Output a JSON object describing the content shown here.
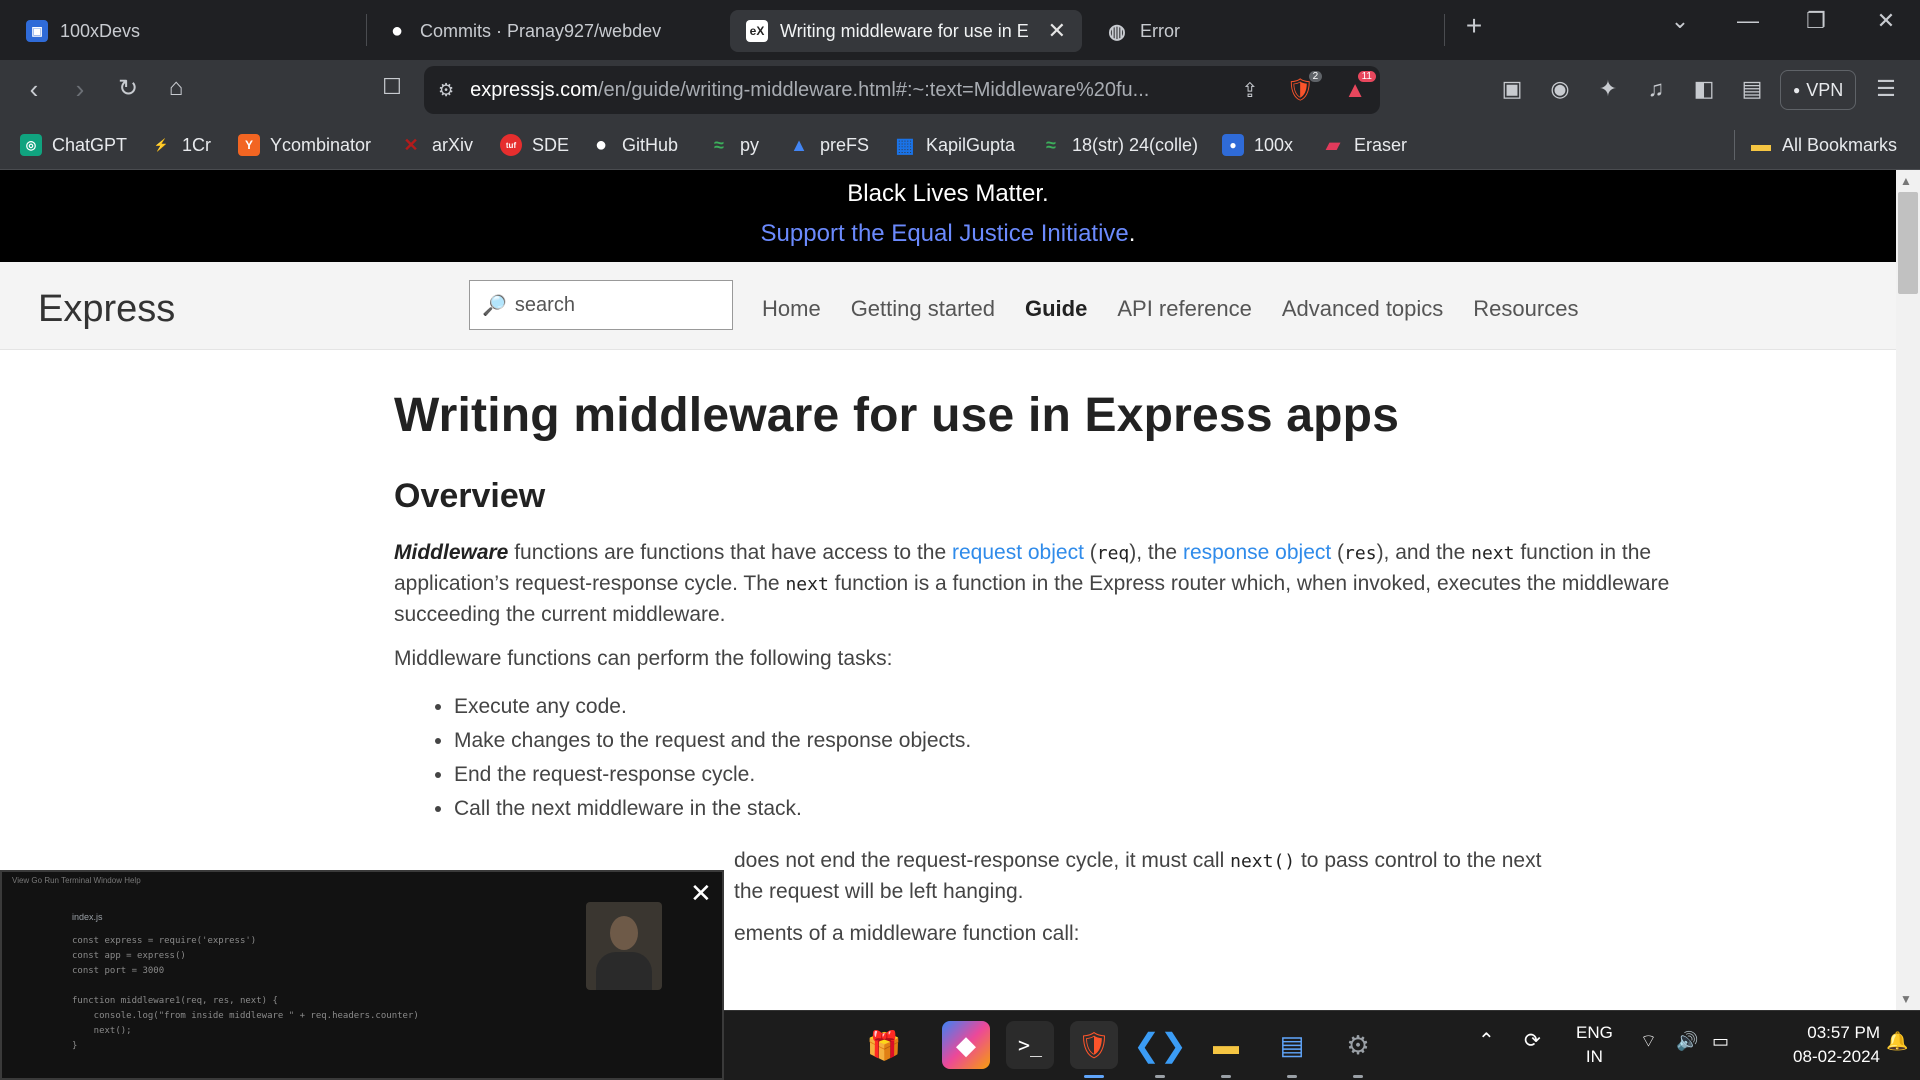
{
  "tabs": [
    {
      "title": "100xDevs",
      "icon": "window-icon"
    },
    {
      "title": "Commits · Pranay927/webdev",
      "icon": "github-icon"
    },
    {
      "title": "Writing middleware for use in Ex",
      "icon": "express-icon",
      "favicon_text": "eX"
    },
    {
      "title": "Error",
      "icon": "globe-icon"
    }
  ],
  "url": {
    "host": "expressjs.com",
    "path": "/en/guide/writing-middleware.html#:~:text=Middleware%20fu..."
  },
  "toolbar": {
    "brave_badge": "2",
    "rewards_badge": "11",
    "vpn_label": "VPN"
  },
  "bookmarks": [
    {
      "label": "ChatGPT",
      "color": "#10a37f",
      "glyph": "◎"
    },
    {
      "label": "1Cr",
      "color": "#f4a31d",
      "glyph": "⚡"
    },
    {
      "label": "Ycombinator",
      "color": "#f26522",
      "glyph": "Y"
    },
    {
      "label": "arXiv",
      "color": "#b31b1b",
      "glyph": "✕"
    },
    {
      "label": "SDE",
      "color": "#e62e2e",
      "glyph": "tuf"
    },
    {
      "label": "GitHub",
      "color": "#ffffff",
      "glyph": "●"
    },
    {
      "label": "py",
      "color": "#3cae5b",
      "glyph": "≈"
    },
    {
      "label": "preFS",
      "color": "#4285f4",
      "glyph": "▲"
    },
    {
      "label": "KapilGupta",
      "color": "#1a73e8",
      "glyph": "▦"
    },
    {
      "label": "18(str) 24(colle)",
      "color": "#3cae5b",
      "glyph": "≈"
    },
    {
      "label": "100x",
      "color": "#2f6bd8",
      "glyph": "●"
    },
    {
      "label": "Eraser",
      "color": "#e23a5b",
      "glyph": "▰"
    }
  ],
  "all_bookmarks": "All Bookmarks",
  "banner": {
    "line1": "Black Lives Matter.",
    "link": "Support the Equal Justice Initiative",
    "link_suffix": "."
  },
  "site": {
    "logo": "Express",
    "search_placeholder": "search",
    "nav": [
      "Home",
      "Getting started",
      "Guide",
      "API reference",
      "Advanced topics",
      "Resources"
    ]
  },
  "article": {
    "title": "Writing middleware for use in Express apps",
    "overview": "Overview",
    "p1_em": "Middleware",
    "p1_a": " functions are functions that have access to the ",
    "p1_link1": "request object",
    "p1_code1": "req",
    "p1_b": "), the ",
    "p1_link2": "response object",
    "p1_code2": "res",
    "p1_c": "), and the ",
    "p1_code3": "next",
    "p1_d": " function in the application’s request-response cycle. The ",
    "p1_code4": "next",
    "p1_e": " function is a function in the Express router which, when invoked, executes the middleware succeeding the current middleware.",
    "p2": "Middleware functions can perform the following tasks:",
    "tasks": [
      "Execute any code.",
      "Make changes to the request and the response objects.",
      "End the request-response cycle.",
      "Call the next middleware in the stack."
    ],
    "p3_visible_a": "does not end the request-response cycle, it must call ",
    "p3_code": "next()",
    "p3_visible_b": " to pass control to the next",
    "p3_line2": "the request will be left hanging.",
    "p4_visible": "ements of a middleware function call:"
  },
  "taskbar": {
    "lang": "ENG",
    "region": "IN",
    "time": "03:57 PM",
    "date": "08-02-2024"
  },
  "pip": {
    "file_tab": "index.js",
    "code": "const express = require('express')\nconst app = express()\nconst port = 3000\n\nfunction middleware1(req, res, next) {\n    console.log(\"from inside middleware \" + req.headers.counter)\n    next();\n}"
  }
}
